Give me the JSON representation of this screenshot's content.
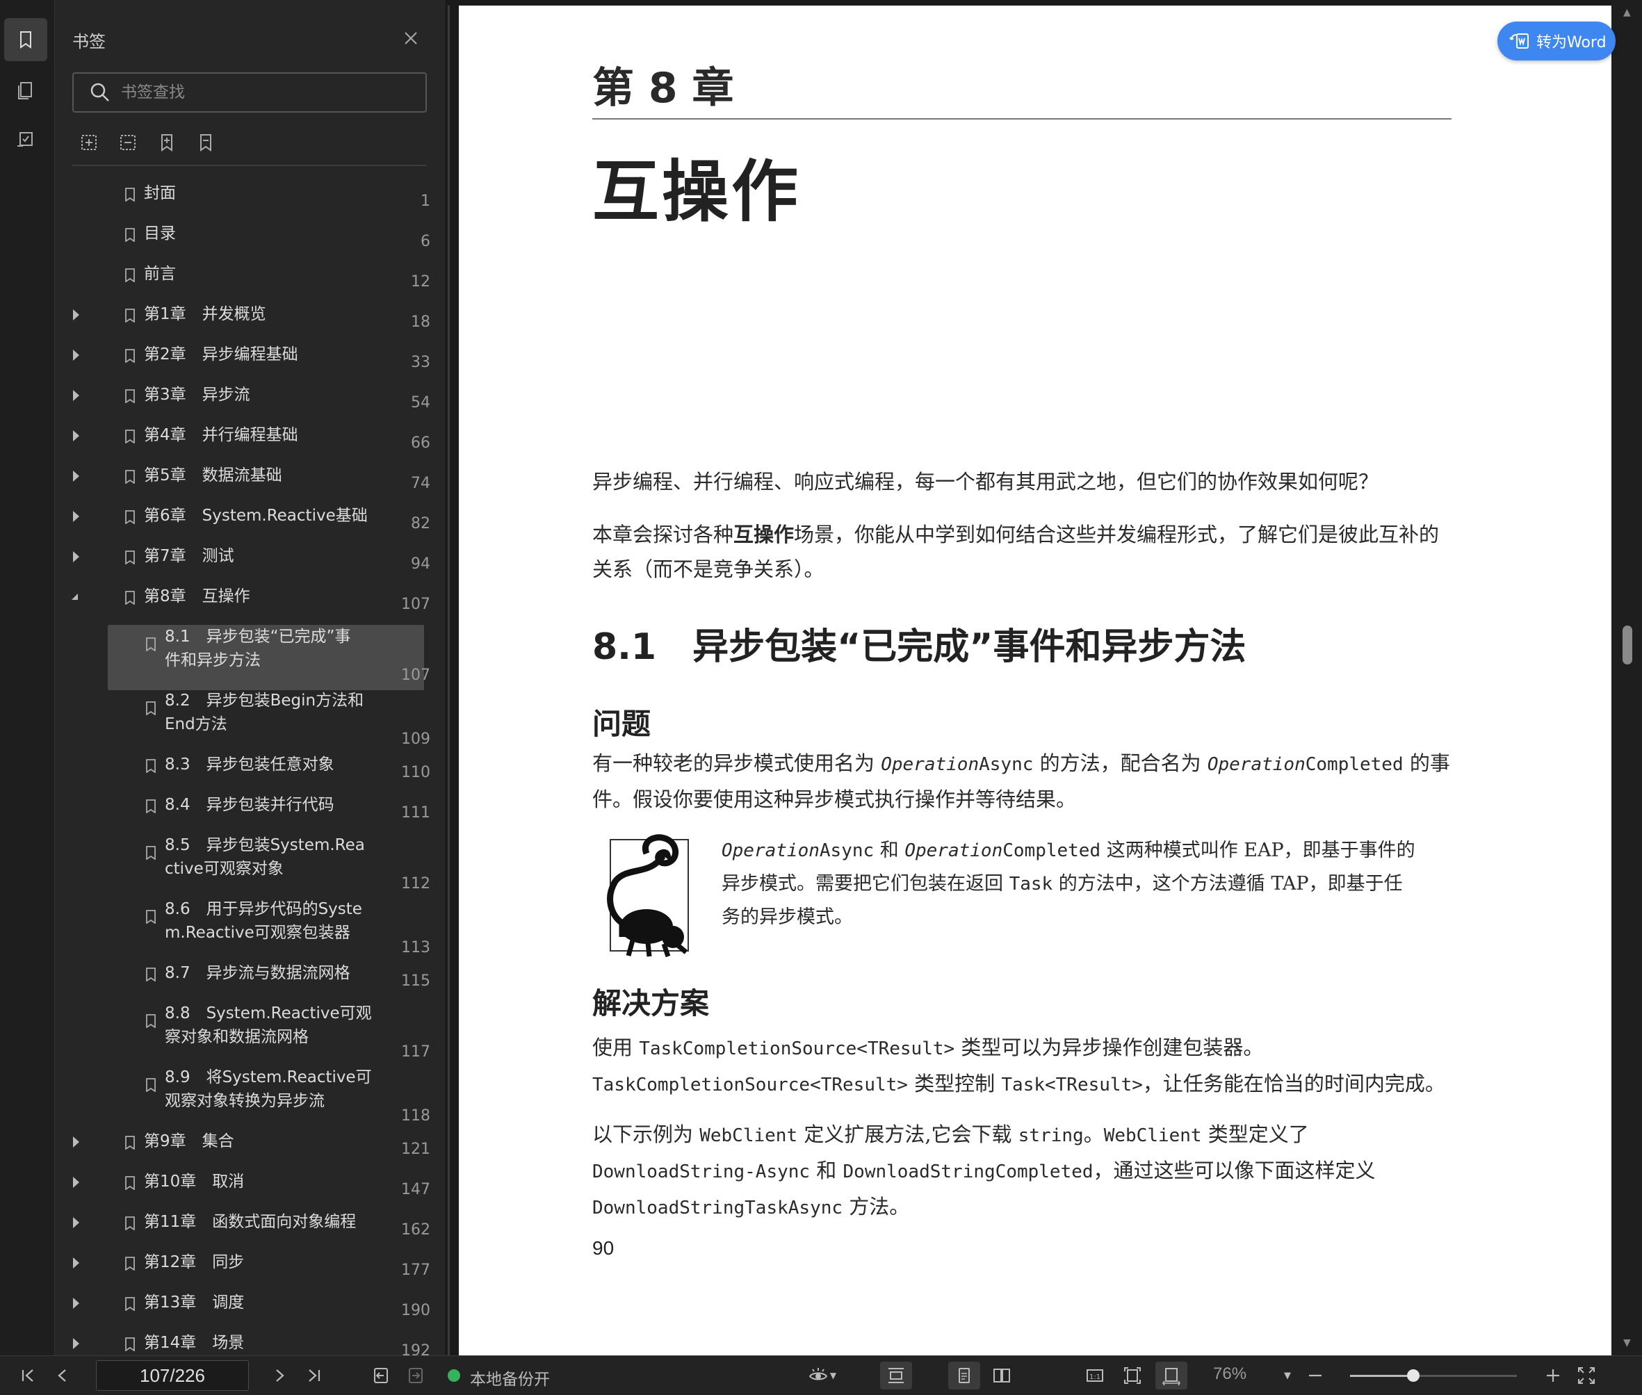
{
  "panel": {
    "title": "书签",
    "search_placeholder": "书签查找",
    "items": [
      {
        "label": "封面",
        "page": "1",
        "level": 0,
        "expander": "none"
      },
      {
        "label": "目录",
        "page": "6",
        "level": 0,
        "expander": "none"
      },
      {
        "label": "前言",
        "page": "12",
        "level": 0,
        "expander": "none"
      },
      {
        "label": "第1章　并发概览",
        "page": "18",
        "level": 0,
        "expander": "closed"
      },
      {
        "label": "第2章　异步编程基础",
        "page": "33",
        "level": 0,
        "expander": "closed"
      },
      {
        "label": "第3章　异步流",
        "page": "54",
        "level": 0,
        "expander": "closed"
      },
      {
        "label": "第4章　并行编程基础",
        "page": "66",
        "level": 0,
        "expander": "closed"
      },
      {
        "label": "第5章　数据流基础",
        "page": "74",
        "level": 0,
        "expander": "closed"
      },
      {
        "label": "第6章　System.Reactive基础",
        "page": "82",
        "level": 0,
        "expander": "closed"
      },
      {
        "label": "第7章　测试",
        "page": "94",
        "level": 0,
        "expander": "closed"
      },
      {
        "label": "第8章　互操作",
        "page": "107",
        "level": 0,
        "expander": "open"
      },
      {
        "label": "8.1　异步包装“已完成”事|件和异步方法",
        "page": "107",
        "level": 1,
        "expander": "none",
        "selected": true
      },
      {
        "label": "8.2　异步包装Begin方法和|End方法",
        "page": "109",
        "level": 1,
        "expander": "none"
      },
      {
        "label": "8.3　异步包装任意对象",
        "page": "110",
        "level": 1,
        "expander": "none"
      },
      {
        "label": "8.4　异步包装并行代码",
        "page": "111",
        "level": 1,
        "expander": "none"
      },
      {
        "label": "8.5　异步包装System.Rea|ctive可观察对象",
        "page": "112",
        "level": 1,
        "expander": "none"
      },
      {
        "label": "8.6　用于异步代码的Syste|m.Reactive可观察包装器",
        "page": "113",
        "level": 1,
        "expander": "none"
      },
      {
        "label": "8.7　异步流与数据流网格",
        "page": "115",
        "level": 1,
        "expander": "none"
      },
      {
        "label": "8.8　System.Reactive可观|察对象和数据流网格",
        "page": "117",
        "level": 1,
        "expander": "none"
      },
      {
        "label": "8.9　将System.Reactive可|观察对象转换为异步流",
        "page": "118",
        "level": 1,
        "expander": "none"
      },
      {
        "label": "第9章　集合",
        "page": "121",
        "level": 0,
        "expander": "closed"
      },
      {
        "label": "第10章　取消",
        "page": "147",
        "level": 0,
        "expander": "closed"
      },
      {
        "label": "第11章　函数式面向对象编程",
        "page": "162",
        "level": 0,
        "expander": "closed"
      },
      {
        "label": "第12章　同步",
        "page": "177",
        "level": 0,
        "expander": "closed"
      },
      {
        "label": "第13章　调度",
        "page": "190",
        "level": 0,
        "expander": "closed"
      },
      {
        "label": "第14章　场景",
        "page": "192",
        "level": 0,
        "expander": "closed"
      }
    ]
  },
  "toword_label": "转为Word",
  "document": {
    "chapter_number": "第 8 章",
    "chapter_title": "互操作",
    "intro_1": "异步编程、并行编程、响应式编程，每一个都有其用武之地，但它们的协作效果如何呢？",
    "intro_2a": "本章会探讨各种",
    "intro_2b": "互操作",
    "intro_2c": "场景，你能从中学到如何结合这些并发编程形式，了解它们是彼此互补的关系（而不是竞争关系）。",
    "section_title": "8.1　异步包装“已完成”事件和异步方法",
    "problem_heading": "问题",
    "problem_a": "有一种较老的异步模式使用名为 ",
    "problem_op1": "Operation",
    "problem_async": "Async",
    "problem_b": " 的方法，配合名为 ",
    "problem_op2": "Operation",
    "problem_completed": "Completed",
    "problem_c": " 的事件。假设你要使用这种异步模式执行操作并等待结果。",
    "note_op1": "Operation",
    "note_async": "Async",
    "note_and": " 和 ",
    "note_op2": "Operation",
    "note_completed": "Completed",
    "note_a": " 这两种模式叫作 EAP，即基于事件的异步模式。需要把它们包装在返回 ",
    "note_task": "Task",
    "note_b": " 的方法中，这个方法遵循 TAP，即基于任务的异步模式。",
    "solution_heading": "解决方案",
    "sol1_a": "使用 ",
    "sol1_tcs1": "TaskCompletionSource<TResult>",
    "sol1_b": " 类型可以为异步操作创建包装器。",
    "sol1_tcs2": "TaskCompletionSource<TResult>",
    "sol1_c": " 类型控制 ",
    "sol1_task": "Task<TResult>",
    "sol1_d": "，让任务能在恰当的时间内完成。",
    "sol2_a": "以下示例为 ",
    "sol2_wc1": "WebClient",
    "sol2_b": " 定义扩展方法,它会下载 ",
    "sol2_str": "string",
    "sol2_c": "。",
    "sol2_wc2": "WebClient",
    "sol2_d": " 类型定义了 ",
    "sol2_dsa": "DownloadString-Async",
    "sol2_e": " 和 ",
    "sol2_dsc": "DownloadStringCompleted",
    "sol2_f": "，通过这些可以像下面这样定义 ",
    "sol2_dsta": "DownloadStringTaskAsync",
    "sol2_g": " 方法。",
    "page_number": "90"
  },
  "bottombar": {
    "page_field": "107/226",
    "status": "本地备份开",
    "zoom": "76%",
    "zoom_fraction": 0.38
  }
}
